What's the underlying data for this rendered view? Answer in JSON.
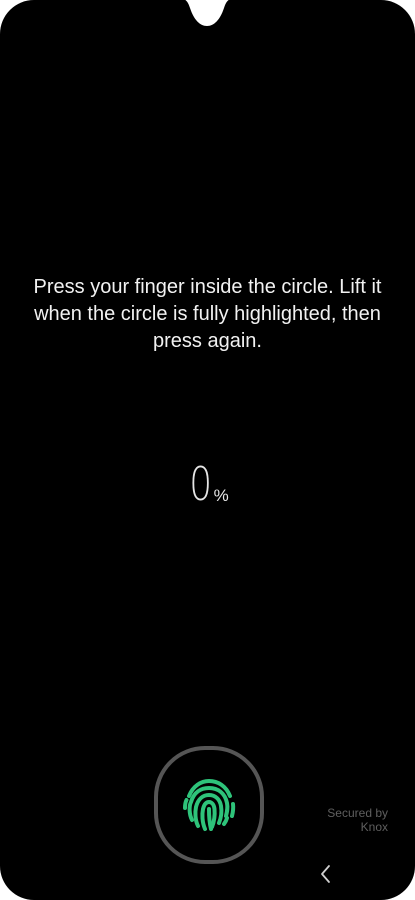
{
  "instruction": {
    "text": "Press your finger inside the circle. Lift it when the circle is fully highlighted, then press again."
  },
  "progress": {
    "value": "0",
    "unit": "%"
  },
  "knox": {
    "line1": "Secured by",
    "line2": "Knox"
  },
  "sensor": {
    "icon": "fingerprint-icon",
    "accent_color": "#2ec37a"
  },
  "navigation": {
    "back_icon": "chevron-left-icon"
  }
}
